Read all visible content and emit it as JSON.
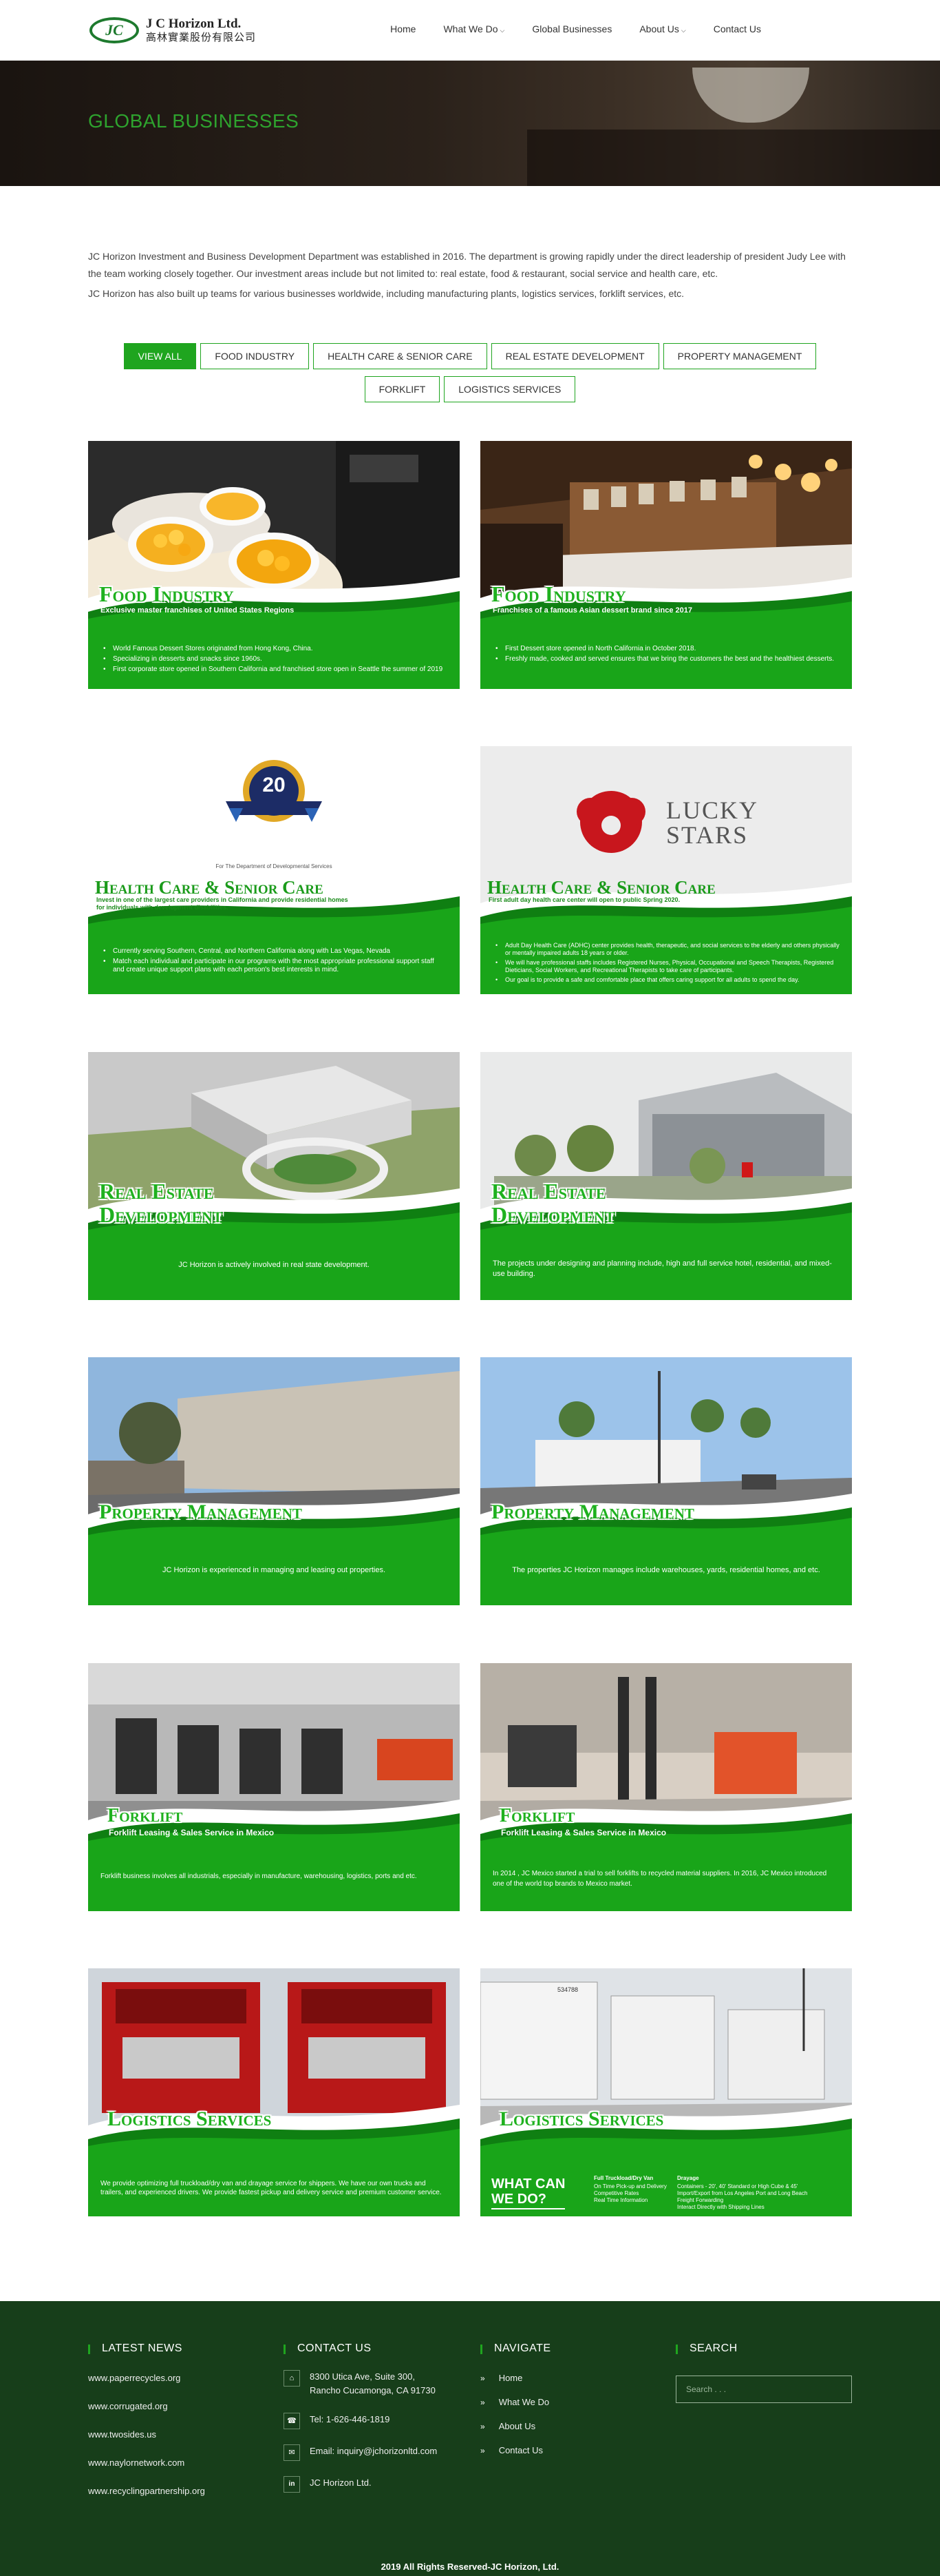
{
  "header": {
    "logo_mark": "JC",
    "logo_en": "J C Horizon Ltd.",
    "logo_cn": "高林實業股份有限公司",
    "nav": [
      "Home",
      "What We Do",
      "Global Businesses",
      "About Us",
      "Contact Us"
    ]
  },
  "hero": {
    "title": "GLOBAL BUSINESSES"
  },
  "intro": {
    "p1": "JC Horizon Investment and Business Development Department was established in 2016. The department is growing rapidly under the direct leadership of president Judy Lee with the team working closely together. Our investment areas include but not limited to: real estate, food & restaurant, social service and health care, etc.",
    "p2": "JC Horizon has also built up teams for various businesses worldwide, including manufacturing plants, logistics services, forklift services, etc."
  },
  "filters": [
    "VIEW ALL",
    "FOOD INDUSTRY",
    "HEALTH CARE & SENIOR CARE",
    "REAL ESTATE DEVELOPMENT",
    "PROPERTY MANAGEMENT",
    "FORKLIFT",
    "LOGISTICS SERVICES"
  ],
  "cards": {
    "food1": {
      "title": "Food Industry",
      "subtitle": "Exclusive master franchises of United States Regions",
      "bullets": [
        "World Famous Dessert Stores originated from Hong Kong, China.",
        "Specializing in desserts and snacks since 1960s.",
        "First corporate store opened in Southern California and franchised store open in Seattle the summer of 2019"
      ]
    },
    "food2": {
      "title": "Food Industry",
      "subtitle": "Franchises of a famous Asian dessert brand since 2017",
      "bullets": [
        "First Dessert store opened in North California in October 2018.",
        "Freshly made, cooked and served ensures that we bring the customers the best and the healthiest desserts."
      ]
    },
    "health1": {
      "badge_number": "20",
      "caption": "For The Department of Developmental Services",
      "title": "Health Care & Senior Care",
      "subtitle": "Invest in one of the largest care providers in California and provide residential homes for individuals with development disabilities.",
      "bullets": [
        "Currently serving Southern, Central, and Northern California along with Las Vegas, Nevada",
        "Match each individual and participate in our programs with the most appropriate professional support staff and create unique support plans with each person's best interests in mind."
      ]
    },
    "health2": {
      "logo_line1": "LUCKY",
      "logo_line2": "STARS",
      "title": "Health Care & Senior Care",
      "subtitle": "First adult day health care center will open to public Spring 2020.",
      "bullets": [
        "Adult Day Health Care (ADHC) center provides health, therapeutic, and social services to the elderly and others physically or mentally impaired adults 18 years or older.",
        "We will have professional staffs includes Registered Nurses, Physical, Occupational and Speech Therapists, Registered Dieticians, Social Workers, and Recreational Therapists to take care of participants.",
        "Our goal is to provide a safe and comfortable place that offers caring support for all adults to spend the day."
      ]
    },
    "real1": {
      "title1": "Real Estate",
      "title2": "Development",
      "desc": "JC Horizon is actively involved in real state development."
    },
    "real2": {
      "title1": "Real Estate",
      "title2": "Development",
      "desc": "The projects under designing and planning include,  high and full service hotel, residential, and mixed-use building."
    },
    "prop1": {
      "title": "Property Management",
      "desc": "JC Horizon is experienced in managing and leasing out properties."
    },
    "prop2": {
      "title": "Property Management",
      "desc": "The properties JC Horizon manages include warehouses, yards, residential homes, and etc."
    },
    "fork1": {
      "title": "Forklift",
      "subtitle": "Forklift Leasing & Sales Service in Mexico",
      "desc": "Forklift business involves all industrials, especially in manufacture, warehousing, logistics, ports and etc."
    },
    "fork2": {
      "title": "Forklift",
      "subtitle": "Forklift Leasing & Sales Service in Mexico",
      "desc": "In 2014 , JC Mexico started a trial to sell forklifts to recycled material suppliers. In 2016, JC Mexico introduced one of the world top brands to Mexico market."
    },
    "log1": {
      "title": "Logistics Services",
      "desc": "We provide optimizing full truckload/dry van and drayage service for shippers. We have our own trucks and trailers, and experienced drivers. We provide fastest pickup and delivery service and premium customer service."
    },
    "log2": {
      "title": "Logistics Services",
      "trailer_number": "534788",
      "whatcan1": "WHAT CAN",
      "whatcan2": "WE DO?",
      "col1_head": "Full Truckload/Dry Van",
      "col1": [
        "On Time Pick-up and Delivery",
        "Competitive Rates",
        "Real Time Information"
      ],
      "col2_head": "Drayage",
      "col2": [
        "Containers - 20', 40' Standard or High Cube & 45'",
        "Import/Export from Los Angeles Port and Long Beach",
        "Freight Forwarding",
        "Interact Directly with Shipping Lines"
      ]
    }
  },
  "footer": {
    "news_head": "LATEST NEWS",
    "news": [
      "www.paperrecycles.org",
      "www.corrugated.org",
      "www.twosides.us",
      "www.naylornetwork.com",
      "www.recyclingpartnership.org"
    ],
    "contact_head": "CONTACT US",
    "address1": "8300 Utica Ave, Suite 300,",
    "address2": "Rancho Cucamonga, CA 91730",
    "tel": "Tel: 1-626-446-1819",
    "email": "Email: inquiry@jchorizonltd.com",
    "linkedin": "JC Horizon Ltd.",
    "navigate_head": "NAVIGATE",
    "navigate": [
      "Home",
      "What We Do",
      "About Us",
      "Contact Us"
    ],
    "search_head": "SEARCH",
    "search_placeholder": "Search . . .",
    "copyright": "2019 All Rights Reserved-JC Horizon, Ltd."
  }
}
